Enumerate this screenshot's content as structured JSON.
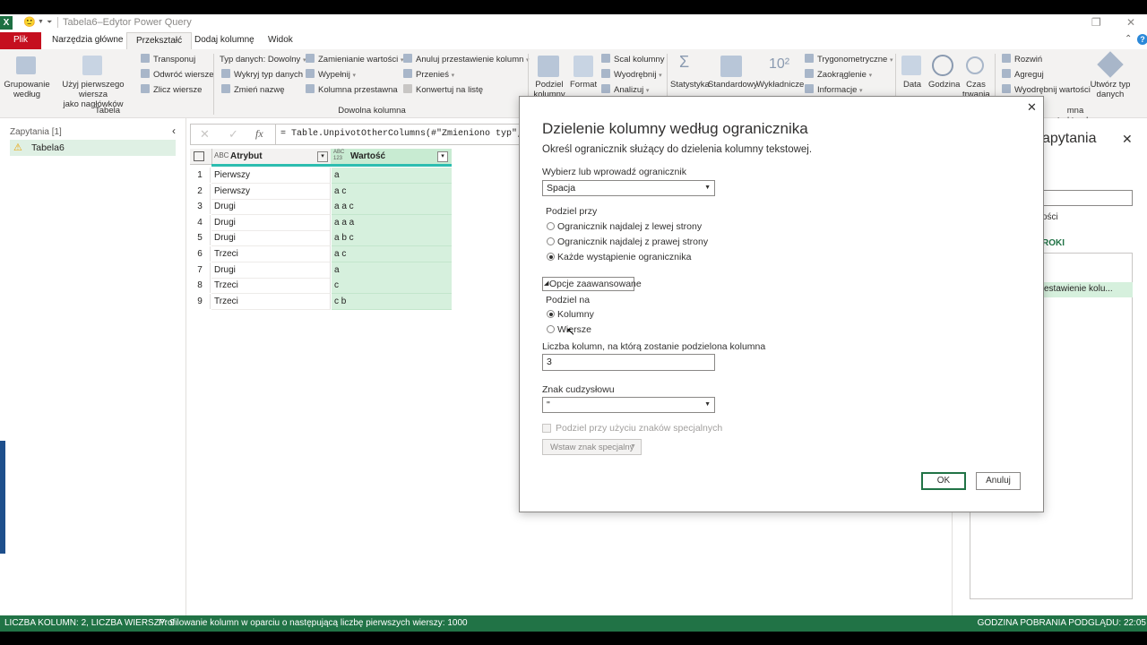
{
  "window": {
    "title": "Tabela6–Edytor Power Query",
    "app_logo": "X"
  },
  "tabs": [
    {
      "label": "Plik"
    },
    {
      "label": "Narzędzia główne"
    },
    {
      "label": "Przekształć"
    },
    {
      "label": "Dodaj kolumnę"
    },
    {
      "label": "Widok"
    }
  ],
  "ribbon": {
    "table_group": {
      "label": "Tabela",
      "group_by": "Grupowanie\nwedług",
      "first_row_headers": "Użyj pierwszego wiersza\njako nagłówków",
      "transpose": "Transponuj",
      "reverse_rows": "Odwróć wiersze",
      "count_rows": "Zlicz wiersze"
    },
    "any_column_group": {
      "label": "Dowolna kolumna",
      "data_type": "Typ danych: Dowolny",
      "detect_type": "Wykryj typ danych",
      "rename": "Zmień nazwę",
      "replace_values": "Zamienianie wartości",
      "fill": "Wypełnij",
      "pivot_column": "Kolumna przestawna",
      "unpivot": "Anuluj przestawienie kolumn",
      "move": "Przenieś",
      "to_list": "Konwertuj na listę"
    },
    "text_group": {
      "split_column": "Podziel\nkolumny",
      "format": "Format",
      "merge_columns": "Scal kolumny",
      "extract": "Wyodrębnij",
      "parse": "Analizuj"
    },
    "number_group": {
      "statistics": "Statystyka",
      "standard": "Standardowy",
      "scientific": "Wykładnicze",
      "trig": "Trygonometryczne",
      "rounding": "Zaokrąglenie",
      "information": "Informacje"
    },
    "datetime_group": {
      "date": "Data",
      "time": "Godzina",
      "duration": "Czas\ntrwania"
    },
    "structured_group": {
      "label": "mna strukturalna",
      "expand": "Rozwiń",
      "aggregate": "Agreguj",
      "extract_values": "Wyodrębnij wartości",
      "create_type": "Utwórz typ\ndanych"
    }
  },
  "queries_pane": {
    "header": "Zapytania [1]",
    "items": [
      {
        "label": "Tabela6",
        "icon": "warning-icon"
      }
    ]
  },
  "formula_bar": {
    "formula": "= Table.UnpivotOtherColumns(#\"Zmieniono typ\", {}"
  },
  "grid": {
    "columns": [
      {
        "name": "Atrybut",
        "type_icon": "ABC"
      },
      {
        "name": "Wartość",
        "type_icon": "ABC 123"
      }
    ],
    "rows": [
      {
        "n": "1",
        "a": "Pierwszy",
        "b": "a"
      },
      {
        "n": "2",
        "a": "Pierwszy",
        "b": "a c"
      },
      {
        "n": "3",
        "a": "Drugi",
        "b": "a a c"
      },
      {
        "n": "4",
        "a": "Drugi",
        "b": "a a a"
      },
      {
        "n": "5",
        "a": "Drugi",
        "b": "a b c"
      },
      {
        "n": "6",
        "a": "Trzeci",
        "b": "a c"
      },
      {
        "n": "7",
        "a": "Drugi",
        "b": "a"
      },
      {
        "n": "8",
        "a": "Trzeci",
        "b": "c"
      },
      {
        "n": "9",
        "a": "Trzeci",
        "b": "c b"
      }
    ]
  },
  "settings_pane": {
    "title_partial": "apytania",
    "properties_partial": "ości",
    "steps_header_partial": "ROKI",
    "step_partial": "estawienie kolu..."
  },
  "dialog": {
    "title": "Dzielenie kolumny według ogranicznika",
    "subtitle": "Określ ogranicznik służący do dzielenia kolumny tekstowej.",
    "delimiter_label": "Wybierz lub wprowadź ogranicznik",
    "delimiter_value": "Spacja",
    "split_at_label": "Podziel przy",
    "split_options": [
      {
        "label": "Ogranicznik najdalej z lewej strony",
        "selected": false
      },
      {
        "label": "Ogranicznik najdalej z prawej strony",
        "selected": false
      },
      {
        "label": "Każde wystąpienie ogranicznika",
        "selected": true
      }
    ],
    "advanced_label": "Opcje zaawansowane",
    "split_into_label": "Podziel na",
    "split_into_options": [
      {
        "label": "Kolumny",
        "selected": true
      },
      {
        "label": "Wiersze",
        "selected": false
      }
    ],
    "num_columns_label": "Liczba kolumn, na którą zostanie podzielona kolumna",
    "num_columns_value": "3",
    "quote_label": "Znak cudzysłowu",
    "quote_value": "\"",
    "special_chars_label": "Podziel przy użyciu znaków specjalnych",
    "insert_special_label": "Wstaw znak specjalny",
    "ok_label": "OK",
    "cancel_label": "Anuluj"
  },
  "status_bar": {
    "counts": "LICZBA KOLUMN: 2, LICZBA WIERSZY: 9",
    "profiling": "Profilowanie kolumn w oparciu o następującą liczbę pierwszych wierszy: 1000",
    "preview_time": "GODZINA POBRANIA PODGLĄDU: 22:05"
  },
  "colors": {
    "status_green": "#217346",
    "file_tab_red": "#c50f1f",
    "selected_column": "#d6f0dd",
    "accent_teal": "#2dbdb0"
  }
}
